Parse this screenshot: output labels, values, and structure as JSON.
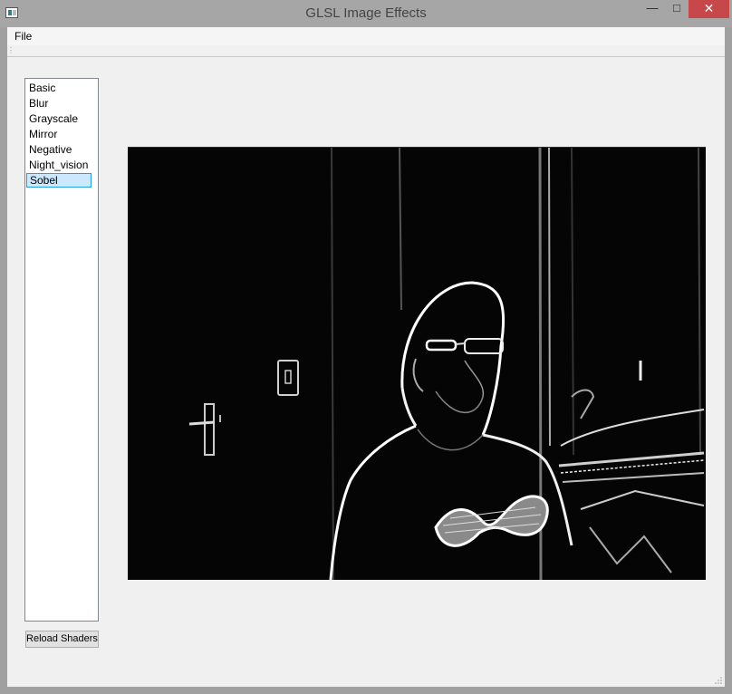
{
  "window": {
    "title": "GLSL Image Effects",
    "controls": {
      "minimize": "—",
      "maximize": "□",
      "close": "✕"
    }
  },
  "menu": {
    "file": "File"
  },
  "shaders": {
    "items": [
      "Basic",
      "Blur",
      "Grayscale",
      "Mirror",
      "Negative",
      "Night_vision",
      "Sobel"
    ],
    "selected": "Sobel"
  },
  "buttons": {
    "reload": "Reload Shaders"
  },
  "image": {
    "effect": "Sobel",
    "description_icon": "edge-detected-webcam-frame"
  },
  "colors": {
    "close": "#c7484a",
    "selection_bg": "#cce8ff",
    "selection_border": "#26a0da"
  }
}
